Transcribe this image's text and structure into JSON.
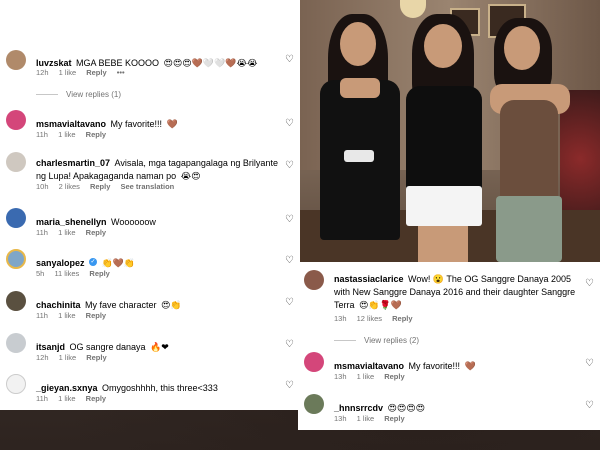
{
  "left_comments": [
    {
      "user": "luvzskat",
      "text": "MGA BEBE KOOOO",
      "emoji": "😍😍😍🤎🤍🤍🤎😭😭",
      "time": "12h",
      "likes": "1 like",
      "reply": "Reply",
      "more": "•••",
      "view_replies": "View replies (1)"
    },
    {
      "user": "msmavialtavano",
      "text": "My favorite!!!",
      "emoji": "🤎",
      "time": "11h",
      "likes": "1 like",
      "reply": "Reply"
    },
    {
      "user": "charlesmartin_07",
      "text": "Avisala, mga tagapangalaga ng Brilyante ng Lupa! Apakagaganda naman po",
      "emoji": "😭😍",
      "time": "10h",
      "likes": "2 likes",
      "reply": "Reply",
      "translation": "See translation"
    },
    {
      "user": "maria_shenellyn",
      "text": "Woooooow",
      "emoji": "",
      "time": "11h",
      "likes": "1 like",
      "reply": "Reply"
    },
    {
      "user": "sanyalopez",
      "text": "",
      "emoji": "👏🤎👏",
      "time": "5h",
      "likes": "11 likes",
      "reply": "Reply",
      "verified": "✓"
    },
    {
      "user": "chachinita",
      "text": "My fave character",
      "emoji": "😍👏",
      "time": "11h",
      "likes": "1 like",
      "reply": "Reply"
    },
    {
      "user": "itsanjd",
      "text": "OG sangre danaya",
      "emoji": "🔥❤",
      "time": "12h",
      "likes": "1 like",
      "reply": "Reply"
    },
    {
      "user": "_gieyan.sxnya",
      "text": "Omygoshhhh, this three<333",
      "emoji": "",
      "time": "11h",
      "likes": "1 like",
      "reply": "Reply"
    }
  ],
  "right_comments": [
    {
      "user": "nastassiaclarice",
      "text": "Wow! 😮 The OG Sanggre Danaya 2005 with New Sanggre Danaya 2016 and their daughter Sanggre Terra",
      "emoji": "😍👏🌹🤎",
      "time": "13h",
      "likes": "12 likes",
      "reply": "Reply",
      "view_replies": "View replies (2)"
    },
    {
      "user": "msmavialtavano",
      "text": "My favorite!!!",
      "emoji": "🤎",
      "time": "13h",
      "likes": "1 like",
      "reply": "Reply"
    },
    {
      "user": "_hnnsrrcdv",
      "text": "",
      "emoji": "😍😍😍😍",
      "time": "13h",
      "likes": "1 like",
      "reply": "Reply"
    }
  ],
  "icons": {
    "heart": "heart-outline-icon"
  }
}
